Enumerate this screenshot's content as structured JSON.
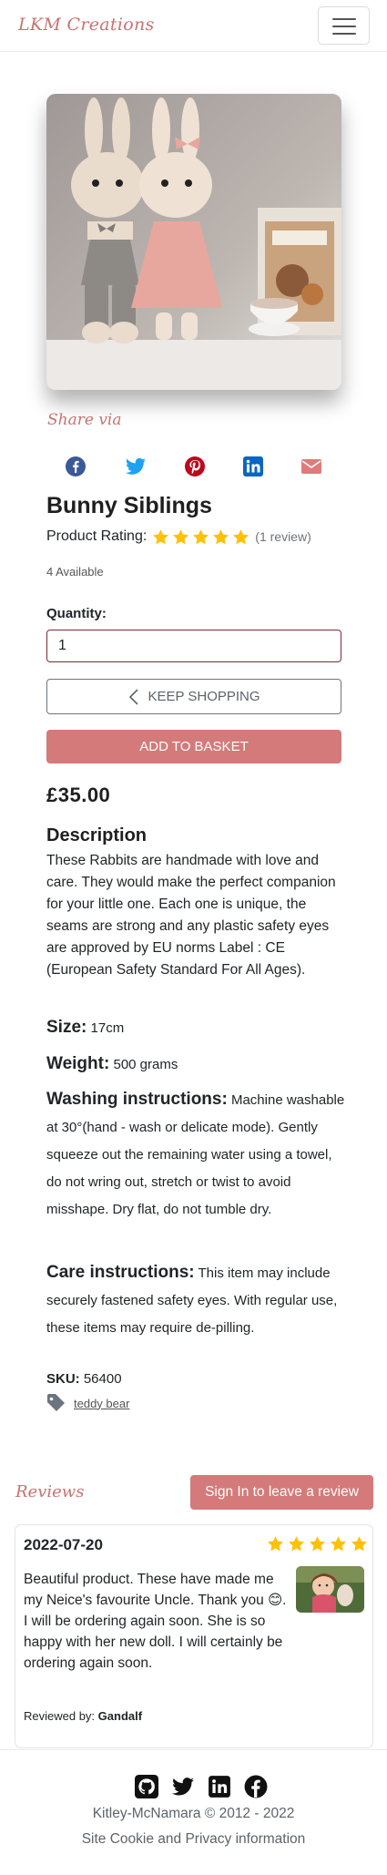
{
  "navbar": {
    "brand": "LKM Creations",
    "menu_icon": "hamburger-menu-icon"
  },
  "product": {
    "image_alt": "Crochet bunny siblings",
    "share_via": "Share via",
    "share_icons": [
      "facebook-icon",
      "twitter-icon",
      "pinterest-icon",
      "linkedin-icon",
      "email-icon"
    ],
    "share_colors": {
      "facebook": "#3b5998",
      "twitter": "#1da1f2",
      "pinterest": "#bd081c",
      "linkedin": "#0a66c2",
      "email": "#e07b7b"
    },
    "title": "Bunny Siblings",
    "rating_label": "Product Rating:",
    "rating": 5,
    "rating_max": 5,
    "rating_count": "(1 review)",
    "available": "4 Available",
    "quantity_label": "Quantity:",
    "quantity_value": "1",
    "keep_shopping": "KEEP SHOPPING",
    "add_to_basket": "ADD TO BASKET",
    "price": "£35.00",
    "description_heading": "Description",
    "description": "These Rabbits are handmade with love and care. They would make the perfect companion for your little one. Each one is unique, the seams are strong and any plastic safety eyes are approved by EU norms Label : CE (European Safety Standard For All Ages).",
    "size_label": "Size:",
    "size_value": "17cm",
    "weight_label": "Weight:",
    "weight_value": "500 grams",
    "washing_label": "Washing instructions:",
    "washing_value": "Machine washable at 30°(hand - wash or delicate mode). Gently squeeze out the remaining water using a towel, do not wring out, stretch or twist to avoid misshape. Dry flat, do not tumble dry.",
    "care_label": "Care instructions:",
    "care_value": "This item may include securely fastened safety eyes. With regular use, these items may require de-pilling.",
    "sku_label": "SKU:",
    "sku_value": "56400",
    "tag": "teddy bear",
    "accent_color": "#d47a7a",
    "star_color": "#ffc107"
  },
  "reviews": {
    "title": "Reviews",
    "signin_button": "Sign In to leave a review",
    "items": [
      {
        "date": "2022-07-20",
        "stars": 5,
        "text": "Beautiful product. These have made me my Neice's favourite Uncle. Thank you 😊. I will be ordering again soon. She is so happy with her new doll. I will certainly be ordering again soon.",
        "reviewed_by_label": "Reviewed by:",
        "reviewer": "Gandalf"
      }
    ]
  },
  "footer": {
    "icons": [
      "github-icon",
      "twitter-icon",
      "linkedin-icon",
      "facebook-icon"
    ],
    "copyright": "Kitley-McNamara © 2012 - 2022",
    "cookie_link": "Site Cookie and Privacy information"
  }
}
